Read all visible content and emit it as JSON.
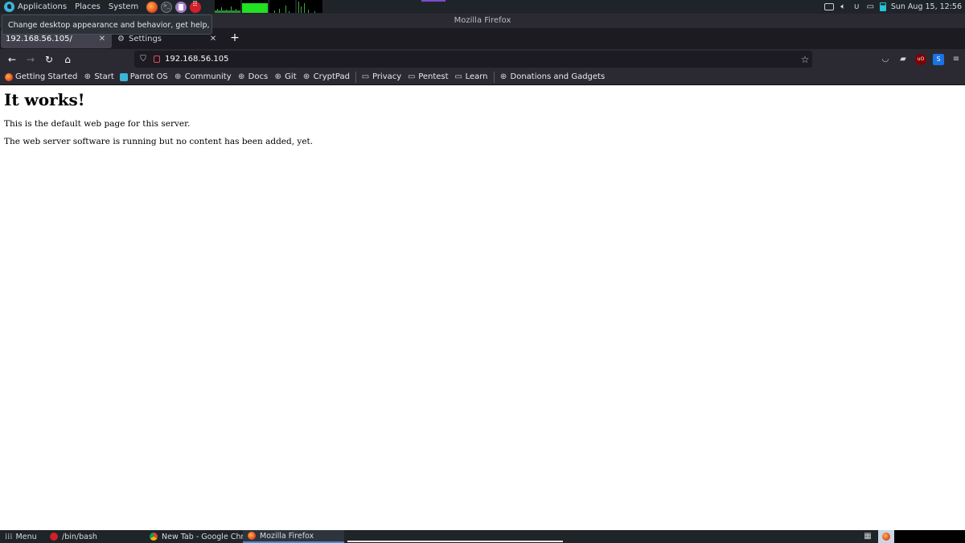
{
  "top_panel": {
    "menus": [
      "Applications",
      "Places",
      "System"
    ],
    "clock": "Sun Aug 15, 12:56"
  },
  "tooltip": "Change desktop appearance and behavior, get help, or log out",
  "window": {
    "title": "Mozilla Firefox"
  },
  "tabs": [
    {
      "title": "192.168.56.105/",
      "active": true
    },
    {
      "title": "Settings",
      "active": false
    }
  ],
  "url": "192.168.56.105",
  "bookmarks": [
    {
      "label": "Getting Started",
      "icon": "firefox-icon"
    },
    {
      "label": "Start",
      "icon": "globe-icon"
    },
    {
      "label": "Parrot OS",
      "icon": "parrot-icon"
    },
    {
      "label": "Community",
      "icon": "globe-icon"
    },
    {
      "label": "Docs",
      "icon": "globe-icon"
    },
    {
      "label": "Git",
      "icon": "globe-icon"
    },
    {
      "label": "CryptPad",
      "icon": "globe-icon"
    },
    {
      "label": "Privacy",
      "icon": "folder-icon"
    },
    {
      "label": "Pentest",
      "icon": "folder-icon"
    },
    {
      "label": "Learn",
      "icon": "folder-icon"
    },
    {
      "label": "Donations and Gadgets",
      "icon": "globe-icon"
    }
  ],
  "page": {
    "heading": "It works!",
    "paragraphs": [
      "This is the default web page for this server.",
      "The web server software is running but no content has been added, yet."
    ]
  },
  "bottom_panel": {
    "menu": "Menu",
    "tasks": [
      "/bin/bash",
      "New Tab - Google Chro...",
      "Mozilla Firefox"
    ]
  },
  "colors": {
    "panel": "#1f2429",
    "firefox_chrome": "#2b2a33",
    "tab_strip": "#1c1b22",
    "active_tab": "#42414d"
  }
}
